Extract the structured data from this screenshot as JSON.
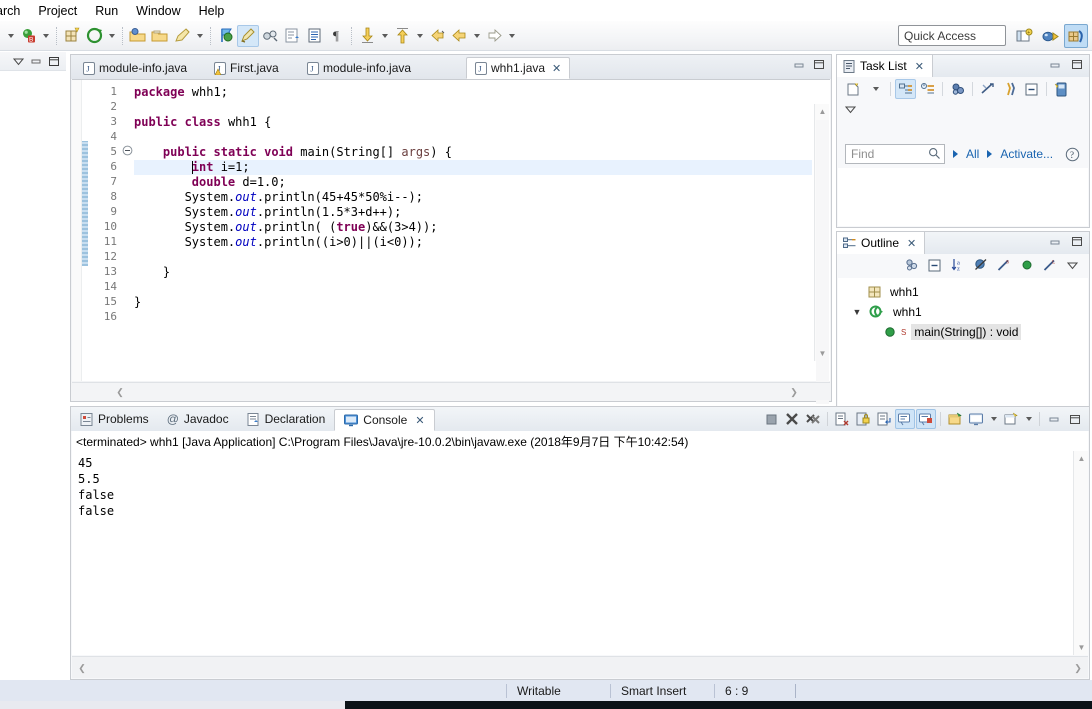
{
  "menu": {
    "items": [
      "arch",
      "Project",
      "Run",
      "Window",
      "Help"
    ]
  },
  "toolbar": {
    "quick_access_placeholder": "Quick Access",
    "buttons": [
      {
        "name": "new-wizard-dropdown",
        "icon": "caret-down"
      },
      {
        "name": "debug-button",
        "icon": "debug-bug"
      },
      {
        "name": "debug-dropdown",
        "icon": "caret-down"
      },
      {
        "name": "new-java-package",
        "icon": "package-new"
      },
      {
        "name": "run-button",
        "icon": "run-green"
      },
      {
        "name": "run-dropdown",
        "icon": "caret-down"
      },
      {
        "name": "open-type",
        "icon": "open-folder-blue"
      },
      {
        "name": "open-task",
        "icon": "open-folder"
      },
      {
        "name": "new-java-class",
        "icon": "pencil"
      },
      {
        "name": "external-tools-dropdown",
        "icon": "caret-down"
      },
      {
        "name": "search-button",
        "icon": "search-flag"
      },
      {
        "name": "toggle-mark-occurrences",
        "icon": "highlight-pen"
      },
      {
        "name": "link-button",
        "icon": "link-chain"
      },
      {
        "name": "open-declaration",
        "icon": "declaration"
      },
      {
        "name": "show-whitespace",
        "icon": "lines-doc"
      },
      {
        "name": "toggle-block-selection",
        "icon": "pilcrow"
      },
      {
        "name": "next-annotation",
        "icon": "down-arrow-yellow"
      },
      {
        "name": "next-annotation-dropdown",
        "icon": "caret-down"
      },
      {
        "name": "previous-annotation",
        "icon": "up-arrow-yellow"
      },
      {
        "name": "previous-annotation-dropdown",
        "icon": "caret-down"
      },
      {
        "name": "last-edit-location",
        "icon": "back-arrow-yellow"
      },
      {
        "name": "back-history",
        "icon": "back-arrow"
      },
      {
        "name": "back-history-dropdown",
        "icon": "caret-down"
      },
      {
        "name": "forward-history",
        "icon": "forward-arrow"
      },
      {
        "name": "forward-history-dropdown",
        "icon": "caret-down"
      }
    ],
    "perspective": [
      {
        "name": "open-perspective",
        "icon": "perspective-new"
      },
      {
        "name": "debug-perspective",
        "icon": "debug-perspective"
      },
      {
        "name": "java-perspective",
        "icon": "java-perspective",
        "selected": true
      }
    ]
  },
  "editor": {
    "tabs": [
      {
        "label": "module-info.java",
        "icon": "java-file",
        "selected": false,
        "warning": false
      },
      {
        "label": "First.java",
        "icon": "java-file-warning",
        "selected": false,
        "warning": true
      },
      {
        "label": "module-info.java",
        "icon": "java-file",
        "selected": false,
        "warning": false
      },
      {
        "label": "whh1.java",
        "icon": "java-file",
        "selected": true,
        "warning": false
      }
    ],
    "close_glyph": "✕",
    "minimize_title": "Minimize",
    "maximize_title": "Maximize",
    "lines": [
      {
        "num": 1,
        "segments": [
          {
            "t": "package",
            "c": "kw"
          },
          {
            "t": " whh1;",
            "c": ""
          }
        ],
        "indent": 0
      },
      {
        "num": 2,
        "segments": [],
        "indent": 0
      },
      {
        "num": 3,
        "segments": [
          {
            "t": "public",
            "c": "kw"
          },
          {
            "t": " ",
            "c": ""
          },
          {
            "t": "class",
            "c": "kw"
          },
          {
            "t": " whh1 {",
            "c": ""
          }
        ],
        "indent": 0
      },
      {
        "num": 4,
        "segments": [],
        "indent": 0
      },
      {
        "num": 5,
        "segments": [
          {
            "t": "    ",
            "c": ""
          },
          {
            "t": "public",
            "c": "kw"
          },
          {
            "t": " ",
            "c": ""
          },
          {
            "t": "static",
            "c": "kw"
          },
          {
            "t": " ",
            "c": ""
          },
          {
            "t": "void",
            "c": "kw"
          },
          {
            "t": " main(String[] ",
            "c": ""
          },
          {
            "t": "args",
            "c": "par"
          },
          {
            "t": ") {",
            "c": ""
          }
        ],
        "indent": 0,
        "fold": true
      },
      {
        "num": 6,
        "segments": [
          {
            "t": "        ",
            "c": ""
          },
          {
            "t": "int",
            "c": "kw"
          },
          {
            "t": " i=1;",
            "c": ""
          }
        ],
        "indent": 0,
        "highlight": true,
        "caret": true
      },
      {
        "num": 7,
        "segments": [
          {
            "t": "        ",
            "c": ""
          },
          {
            "t": "double",
            "c": "kw"
          },
          {
            "t": " d=1.0;",
            "c": ""
          }
        ],
        "indent": 0
      },
      {
        "num": 8,
        "segments": [
          {
            "t": "       System.",
            "c": ""
          },
          {
            "t": "out",
            "c": "fld"
          },
          {
            "t": ".println(45+45*50%i--);",
            "c": ""
          }
        ],
        "indent": 0
      },
      {
        "num": 9,
        "segments": [
          {
            "t": "       System.",
            "c": ""
          },
          {
            "t": "out",
            "c": "fld"
          },
          {
            "t": ".println(1.5*3+d++);",
            "c": ""
          }
        ],
        "indent": 0
      },
      {
        "num": 10,
        "segments": [
          {
            "t": "       System.",
            "c": ""
          },
          {
            "t": "out",
            "c": "fld"
          },
          {
            "t": ".println( (",
            "c": ""
          },
          {
            "t": "true",
            "c": "kw"
          },
          {
            "t": ")&&(3>4));",
            "c": ""
          }
        ],
        "indent": 0
      },
      {
        "num": 11,
        "segments": [
          {
            "t": "       System.",
            "c": ""
          },
          {
            "t": "out",
            "c": "fld"
          },
          {
            "t": ".println((i>0)||(i<0));",
            "c": ""
          }
        ],
        "indent": 0
      },
      {
        "num": 12,
        "segments": [],
        "indent": 0
      },
      {
        "num": 13,
        "segments": [
          {
            "t": "    }",
            "c": ""
          }
        ],
        "indent": 0
      },
      {
        "num": 14,
        "segments": [],
        "indent": 0
      },
      {
        "num": 15,
        "segments": [
          {
            "t": "}",
            "c": ""
          }
        ],
        "indent": 0
      },
      {
        "num": 16,
        "segments": [],
        "indent": 0
      }
    ]
  },
  "task_list": {
    "title": "Task List",
    "close_glyph": "✕",
    "find_placeholder": "Find",
    "all_label": "All",
    "activate_label": "Activate...",
    "help_glyph": "?",
    "buttons": [
      {
        "name": "new-task-button",
        "icon": "new-task"
      },
      {
        "name": "new-task-dropdown",
        "icon": "caret-down"
      },
      {
        "name": "categorized-presentation-button",
        "icon": "categorized",
        "on": true
      },
      {
        "name": "scheduled-presentation-button",
        "icon": "scheduled"
      },
      {
        "name": "focus-on-workweek-button",
        "icon": "focus"
      },
      {
        "name": "synchronize-changed-button",
        "icon": "synchronize"
      },
      {
        "name": "restore-tasks-button",
        "icon": "restore"
      },
      {
        "name": "collapse-all-button",
        "icon": "collapse-all"
      },
      {
        "name": "view-menu-button",
        "icon": "view-menu"
      }
    ]
  },
  "outline": {
    "title": "Outline",
    "close_glyph": "✕",
    "buttons": [
      {
        "name": "focus-on-active-task-button",
        "icon": "focus-task"
      },
      {
        "name": "collapse-all-button",
        "icon": "collapse-all"
      },
      {
        "name": "sort-button",
        "icon": "sort-az"
      },
      {
        "name": "hide-fields-button",
        "icon": "hide-fields"
      },
      {
        "name": "hide-static-button",
        "icon": "hide-static"
      },
      {
        "name": "hide-nonpublic-button",
        "icon": "hide-nonpublic"
      },
      {
        "name": "hide-local-types-button",
        "icon": "hide-local"
      },
      {
        "name": "view-menu-button",
        "icon": "view-menu"
      }
    ],
    "tree": [
      {
        "label": "whh1",
        "icon": "package-icon",
        "level": 0,
        "expandable": false,
        "selected": false
      },
      {
        "label": "whh1",
        "icon": "class-icon",
        "level": 0,
        "expandable": true,
        "expanded": true,
        "selected": false
      },
      {
        "label": "main(String[]) : void",
        "icon": "method-icon",
        "level": 1,
        "expandable": false,
        "selected": true,
        "static_marker": "S"
      }
    ]
  },
  "console": {
    "tabs": [
      {
        "label": "Problems",
        "icon": "problems-icon",
        "selected": false
      },
      {
        "label": "Javadoc",
        "icon": "javadoc-icon",
        "selected": false
      },
      {
        "label": "Declaration",
        "icon": "declaration-icon",
        "selected": false
      },
      {
        "label": "Console",
        "icon": "console-icon",
        "selected": true
      }
    ],
    "close_glyph": "✕",
    "process_line": "<terminated> whh1 [Java Application] C:\\Program Files\\Java\\jre-10.0.2\\bin\\javaw.exe (2018年9月7日 下午10:42:54)",
    "output_lines": [
      "45",
      "5.5",
      "false",
      "false"
    ],
    "buttons": [
      {
        "name": "terminate-button",
        "icon": "terminate-square"
      },
      {
        "name": "remove-launch-button",
        "icon": "remove-x"
      },
      {
        "name": "remove-all-terminated-button",
        "icon": "remove-all-xx"
      },
      {
        "name": "clear-console-button",
        "icon": "clear-console"
      },
      {
        "name": "scroll-lock-button",
        "icon": "scroll-lock"
      },
      {
        "name": "word-wrap-button",
        "icon": "word-wrap"
      },
      {
        "name": "show-console-on-output-button",
        "icon": "show-on-output",
        "on": true
      },
      {
        "name": "show-console-on-error-button",
        "icon": "show-on-error",
        "on": true
      },
      {
        "name": "pin-console-button",
        "icon": "pin-console"
      },
      {
        "name": "display-selected-console-button",
        "icon": "display-console"
      },
      {
        "name": "display-selected-console-dropdown",
        "icon": "caret-down"
      },
      {
        "name": "open-console-button",
        "icon": "open-console"
      },
      {
        "name": "open-console-dropdown",
        "icon": "caret-down"
      },
      {
        "name": "minimize-button",
        "icon": "minimize"
      },
      {
        "name": "maximize-button",
        "icon": "maximize"
      }
    ]
  },
  "status_bar": {
    "writable": "Writable",
    "insert_mode": "Smart Insert",
    "cursor_position": "6 : 9"
  },
  "colors": {
    "keyword": "#7f0055",
    "field": "#0000c0",
    "parameter": "#6a3e3e",
    "selection": "#e8f2fe",
    "accent_blue": "#1a64b0",
    "panel_bg": "#f7f8fa",
    "status_bg": "#e1e7f2"
  }
}
